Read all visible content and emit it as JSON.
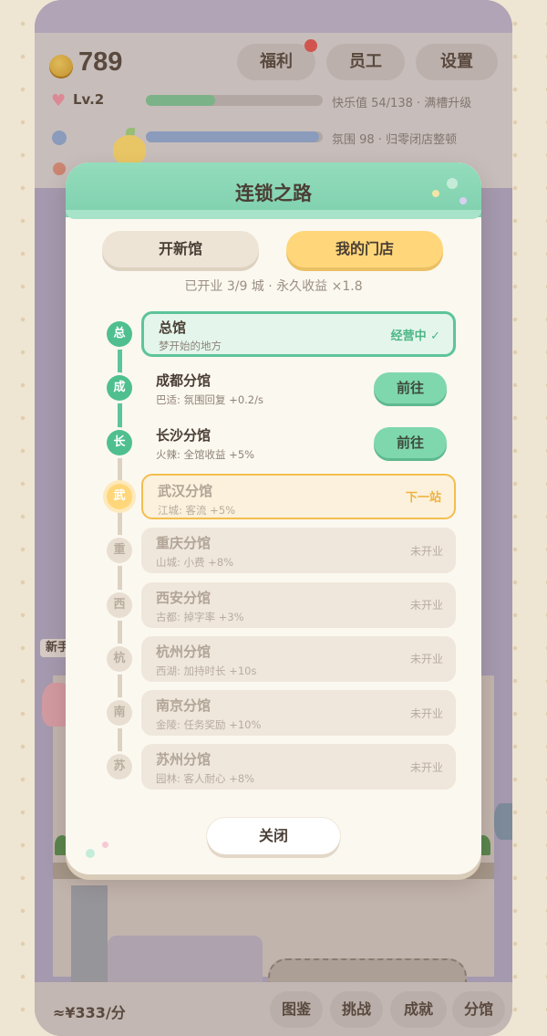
{
  "hud": {
    "coins": "789",
    "welfare": "福利",
    "staff": "员工",
    "settings": "设置",
    "level": "Lv.2",
    "happiness_text": "快乐值 54/138 · 满槽升级",
    "happiness_progress": 0.39,
    "atmosphere_text": "氛围 98 · 归零闭店整顿",
    "atmosphere_progress": 0.98
  },
  "scene": {
    "side_label": "新手"
  },
  "modal": {
    "title": "连锁之路",
    "tab_new": "开新馆",
    "tab_mine": "我的门店",
    "summary": "已开业 3/9 城 · 永久收益 ×1.8",
    "close": "关闭",
    "branches": [
      {
        "node": "总",
        "name": "总馆",
        "sub": "梦开始的地方",
        "state": "current",
        "status": "经营中 ✓"
      },
      {
        "node": "成",
        "name": "成都分馆",
        "sub": "巴适: 氛围回复 +0.2/s",
        "state": "unlocked",
        "status": "前往"
      },
      {
        "node": "长",
        "name": "长沙分馆",
        "sub": "火辣: 全馆收益 +5%",
        "state": "unlocked",
        "status": "前往"
      },
      {
        "node": "武",
        "name": "武汉分馆",
        "sub": "江城: 客流 +5%",
        "state": "next",
        "status": "下一站"
      },
      {
        "node": "重",
        "name": "重庆分馆",
        "sub": "山城: 小费 +8%",
        "state": "locked",
        "status": "未开业"
      },
      {
        "node": "西",
        "name": "西安分馆",
        "sub": "古都: 掉字率 +3%",
        "state": "locked",
        "status": "未开业"
      },
      {
        "node": "杭",
        "name": "杭州分馆",
        "sub": "西湖: 加持时长 +10s",
        "state": "locked",
        "status": "未开业"
      },
      {
        "node": "南",
        "name": "南京分馆",
        "sub": "金陵: 任务奖励 +10%",
        "state": "locked",
        "status": "未开业"
      },
      {
        "node": "苏",
        "name": "苏州分馆",
        "sub": "园林: 客人耐心 +8%",
        "state": "locked",
        "status": "未开业"
      }
    ]
  },
  "bottom": {
    "rate": "≈¥333/分",
    "catalog": "图鉴",
    "challenge": "挑战",
    "achievement": "成就",
    "branches": "分馆"
  },
  "colors": {
    "accent_green": "#5ec49a",
    "accent_yellow": "#ffd77a",
    "happiness_bar": "#7fb98d",
    "atmosphere_bar": "#8ea1c4"
  }
}
